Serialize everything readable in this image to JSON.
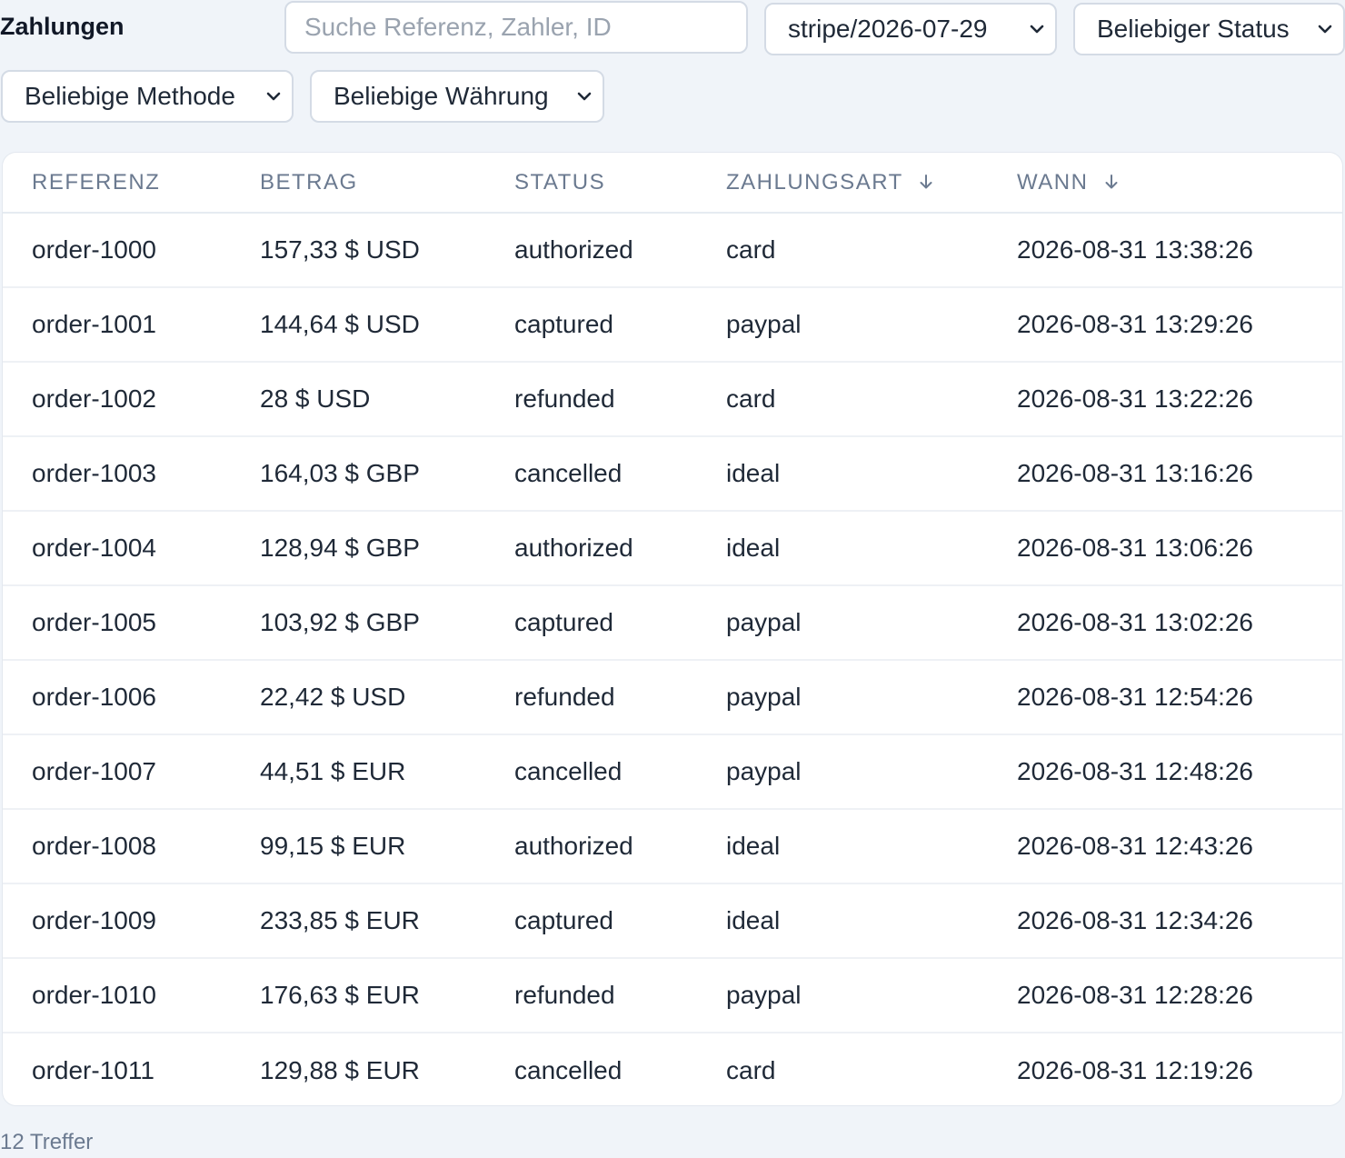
{
  "header": {
    "title": "Zahlungen",
    "search_placeholder": "Suche Referenz, Zahler, ID",
    "search_value": ""
  },
  "filters": {
    "account": "stripe/2026-07-29",
    "status": "Beliebiger Status",
    "method": "Beliebige Methode",
    "currency": "Beliebige Währung"
  },
  "table": {
    "columns": {
      "reference": "REFERENZ",
      "amount": "BETRAG",
      "status": "STATUS",
      "method": "ZAHLUNGSART",
      "when": "WANN"
    },
    "sort_icon": "arrow-down-icon",
    "rows": [
      {
        "reference": "order-1000",
        "amount": "157,33 $ USD",
        "status": "authorized",
        "method": "card",
        "when": "2026-08-31 13:38:26"
      },
      {
        "reference": "order-1001",
        "amount": "144,64 $ USD",
        "status": "captured",
        "method": "paypal",
        "when": "2026-08-31 13:29:26"
      },
      {
        "reference": "order-1002",
        "amount": "28 $ USD",
        "status": "refunded",
        "method": "card",
        "when": "2026-08-31 13:22:26"
      },
      {
        "reference": "order-1003",
        "amount": "164,03 $ GBP",
        "status": "cancelled",
        "method": "ideal",
        "when": "2026-08-31 13:16:26"
      },
      {
        "reference": "order-1004",
        "amount": "128,94 $ GBP",
        "status": "authorized",
        "method": "ideal",
        "when": "2026-08-31 13:06:26"
      },
      {
        "reference": "order-1005",
        "amount": "103,92 $ GBP",
        "status": "captured",
        "method": "paypal",
        "when": "2026-08-31 13:02:26"
      },
      {
        "reference": "order-1006",
        "amount": "22,42 $ USD",
        "status": "refunded",
        "method": "paypal",
        "when": "2026-08-31 12:54:26"
      },
      {
        "reference": "order-1007",
        "amount": "44,51 $ EUR",
        "status": "cancelled",
        "method": "paypal",
        "when": "2026-08-31 12:48:26"
      },
      {
        "reference": "order-1008",
        "amount": "99,15 $ EUR",
        "status": "authorized",
        "method": "ideal",
        "when": "2026-08-31 12:43:26"
      },
      {
        "reference": "order-1009",
        "amount": "233,85 $ EUR",
        "status": "captured",
        "method": "ideal",
        "when": "2026-08-31 12:34:26"
      },
      {
        "reference": "order-1010",
        "amount": "176,63 $ EUR",
        "status": "refunded",
        "method": "paypal",
        "when": "2026-08-31 12:28:26"
      },
      {
        "reference": "order-1011",
        "amount": "129,88 $ EUR",
        "status": "cancelled",
        "method": "card",
        "when": "2026-08-31 12:19:26"
      }
    ]
  },
  "footer": {
    "result_count": "12 Treffer"
  },
  "colors": {
    "background": "#f0f4f9",
    "header_text": "#6b7a90",
    "body_text": "#1f2937"
  }
}
